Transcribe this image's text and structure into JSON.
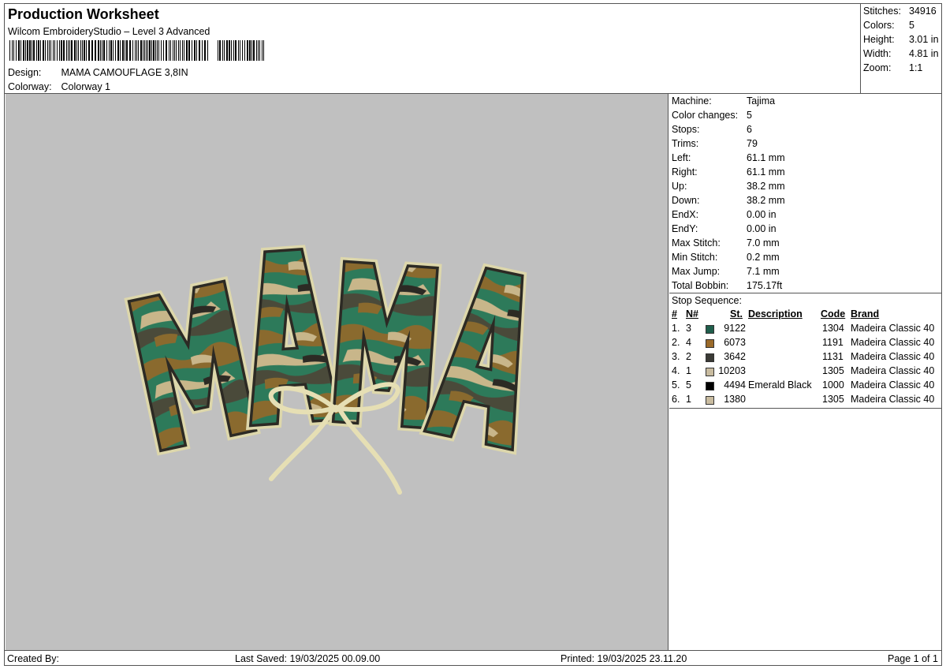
{
  "header": {
    "title": "Production Worksheet",
    "subtitle": "Wilcom EmbroideryStudio – Level 3 Advanced",
    "design_label": "Design:",
    "design_value": "MAMA CAMOUFLAGE 3,8IN",
    "colorway_label": "Colorway:",
    "colorway_value": "Colorway 1"
  },
  "summary": {
    "stitches_label": "Stitches:",
    "stitches": "34916",
    "colors_label": "Colors:",
    "colors": "5",
    "height_label": "Height:",
    "height": "3.01 in",
    "width_label": "Width:",
    "width": "4.81 in",
    "zoom_label": "Zoom:",
    "zoom": "1:1"
  },
  "design": {
    "text": "MAMA",
    "colors": {
      "background": "#c0c0c0",
      "outline": "#ddd7ab",
      "dark": "#2c2a24",
      "green": "#2d7a5a",
      "brown": "#8a6a2e",
      "tan": "#c8b68a",
      "olive": "#4a4a3a",
      "bow": "#e6dfb4"
    }
  },
  "properties": [
    {
      "label": "Machine:",
      "value": "Tajima"
    },
    {
      "label": "Color changes:",
      "value": "5"
    },
    {
      "label": "Stops:",
      "value": "6"
    },
    {
      "label": "Trims:",
      "value": "79"
    },
    {
      "label": "Left:",
      "value": "61.1 mm"
    },
    {
      "label": "Right:",
      "value": "61.1 mm"
    },
    {
      "label": "Up:",
      "value": "38.2 mm"
    },
    {
      "label": "Down:",
      "value": "38.2 mm"
    },
    {
      "label": "EndX:",
      "value": "0.00 in"
    },
    {
      "label": "EndY:",
      "value": "0.00 in"
    },
    {
      "label": "Max Stitch:",
      "value": "7.0 mm"
    },
    {
      "label": "Min Stitch:",
      "value": "0.2 mm"
    },
    {
      "label": "Max Jump:",
      "value": "7.1 mm"
    },
    {
      "label": "Total Bobbin:",
      "value": "175.17ft"
    }
  ],
  "stop_sequence": {
    "title": "Stop Sequence:",
    "headers": {
      "num": "#",
      "n": "N#",
      "st": "St.",
      "desc": "Description",
      "code": "Code",
      "brand": "Brand"
    },
    "rows": [
      {
        "num": "1.",
        "n": "3",
        "color": "#1f5e4c",
        "st": "9122",
        "desc": "",
        "code": "1304",
        "brand": "Madeira Classic 40"
      },
      {
        "num": "2.",
        "n": "4",
        "color": "#9a6a2a",
        "st": "6073",
        "desc": "",
        "code": "1191",
        "brand": "Madeira Classic 40"
      },
      {
        "num": "3.",
        "n": "2",
        "color": "#3a3a36",
        "st": "3642",
        "desc": "",
        "code": "1131",
        "brand": "Madeira Classic 40"
      },
      {
        "num": "4.",
        "n": "1",
        "color": "#c9bca0",
        "st": "10203",
        "desc": "",
        "code": "1305",
        "brand": "Madeira Classic 40"
      },
      {
        "num": "5.",
        "n": "5",
        "color": "#000000",
        "st": "4494",
        "desc": "Emerald Black",
        "code": "1000",
        "brand": "Madeira Classic 40"
      },
      {
        "num": "6.",
        "n": "1",
        "color": "#c9bca0",
        "st": "1380",
        "desc": "",
        "code": "1305",
        "brand": "Madeira Classic 40"
      }
    ]
  },
  "footer": {
    "created_by": "Created By:",
    "last_saved": "Last Saved: 19/03/2025 00.09.00",
    "printed": "Printed: 19/03/2025 23.11.20",
    "page": "Page 1 of 1"
  }
}
